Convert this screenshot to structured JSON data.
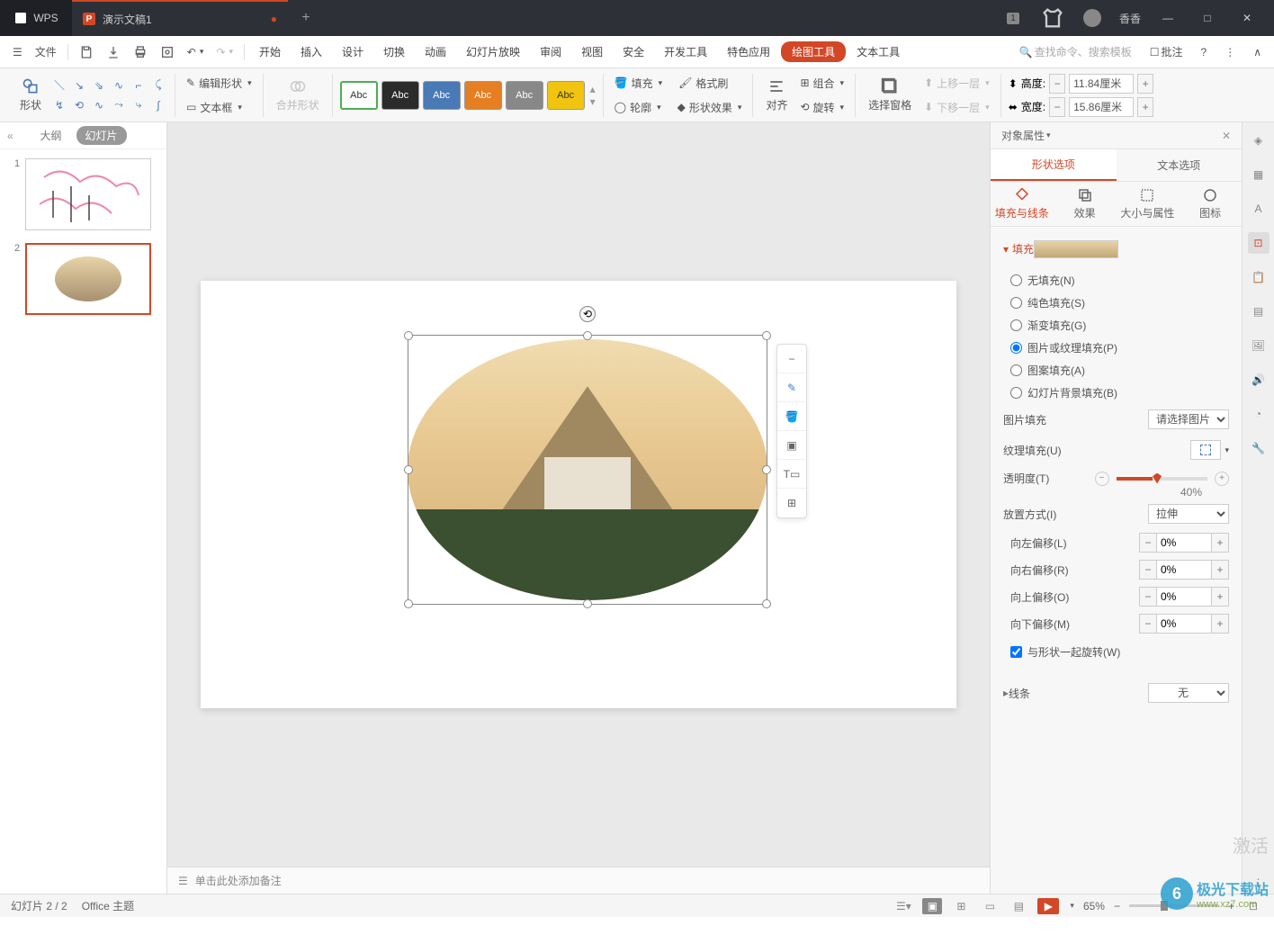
{
  "title": {
    "wps": "WPS",
    "doc": "演示文稿1"
  },
  "titlebar_right": {
    "badge": "1",
    "user": "香香"
  },
  "menubar": {
    "file": "文件",
    "tabs": [
      "开始",
      "插入",
      "设计",
      "切换",
      "动画",
      "幻灯片放映",
      "审阅",
      "视图",
      "安全",
      "开发工具",
      "特色应用",
      "绘图工具",
      "文本工具"
    ],
    "active_tab": "绘图工具",
    "search_placeholder": "查找命令、搜索模板",
    "annotate": "批注"
  },
  "toolbar": {
    "shape": "形状",
    "edit_shape": "编辑形状",
    "textbox": "文本框",
    "merge": "合并形状",
    "style_label": "Abc",
    "fill": "填充",
    "outline": "轮廓",
    "format_painter": "格式刷",
    "shape_effect": "形状效果",
    "align": "对齐",
    "group": "组合",
    "rotate": "旋转",
    "sel_pane": "选择窗格",
    "bring_fwd": "上移一层",
    "send_back": "下移一层",
    "height_lbl": "高度:",
    "width_lbl": "宽度:",
    "height_val": "11.84厘米",
    "width_val": "15.86厘米"
  },
  "slidepanel": {
    "outline": "大纲",
    "slides": "幻灯片",
    "nums": [
      "1",
      "2"
    ]
  },
  "notes": {
    "placeholder": "单击此处添加备注"
  },
  "float_tb": {
    "icons": [
      "minus",
      "pen",
      "bucket",
      "layers",
      "textbox",
      "grid"
    ]
  },
  "prop": {
    "title": "对象属性",
    "tabs": {
      "shape": "形状选项",
      "text": "文本选项"
    },
    "subtabs": {
      "fill": "填充与线条",
      "effect": "效果",
      "size": "大小与属性",
      "icon": "图标"
    },
    "section_fill": "填充",
    "fill_opts": {
      "none": "无填充(N)",
      "solid": "纯色填充(S)",
      "gradient": "渐变填充(G)",
      "picture": "图片或纹理填充(P)",
      "pattern": "图案填充(A)",
      "slidebg": "幻灯片背景填充(B)"
    },
    "pic_fill": "图片填充",
    "pic_sel": "请选择图片",
    "tex_fill": "纹理填充(U)",
    "transparency": "透明度(T)",
    "trans_val": "40%",
    "tile": "放置方式(I)",
    "tile_val": "拉伸",
    "offsets": {
      "left": "向左偏移(L)",
      "right": "向右偏移(R)",
      "top": "向上偏移(O)",
      "bottom": "向下偏移(M)",
      "val": "0%"
    },
    "rotate_with": "与形状一起旋转(W)",
    "section_line": "线条",
    "line_val": "无"
  },
  "status": {
    "slide": "幻灯片 2 / 2",
    "theme": "Office 主题",
    "zoom": "65%"
  },
  "watermark": {
    "title": "极光下载站",
    "url": "www.xz7.com"
  },
  "activate": "激活"
}
